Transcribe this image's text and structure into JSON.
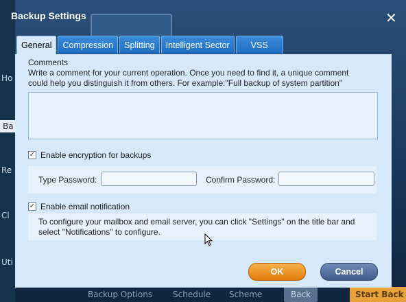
{
  "dialog": {
    "title": "Backup Settings"
  },
  "tabs": [
    {
      "label": "General",
      "active": true
    },
    {
      "label": "Compression",
      "active": false
    },
    {
      "label": "Splitting",
      "active": false
    },
    {
      "label": "Intelligent Sector",
      "active": false
    },
    {
      "label": "VSS",
      "active": false
    }
  ],
  "general": {
    "comments_heading": "Comments",
    "comments_description_line1": "Write a comment for your current operation. Once you need to find it, a unique comment",
    "comments_description_line2": "could help you distinguish it from others. For example:\"Full backup of system partition\"",
    "comment_value": "",
    "encryption_label": "Enable encryption for backups",
    "encryption_checked": true,
    "type_password_label": "Type Password:",
    "confirm_password_label": "Confirm Password:",
    "type_password_value": "",
    "confirm_password_value": "",
    "email_label": "Enable email notification",
    "email_checked": true,
    "email_info_line1": "To configure your mailbox and email server, you can click \"Settings\" on the title bar and",
    "email_info_line2": "select \"Notifications\" to configure."
  },
  "buttons": {
    "ok": "OK",
    "cancel": "Cancel"
  },
  "background": {
    "sidebar_items": [
      "Ho",
      "Ba",
      "Re",
      "Cl",
      "Uti"
    ],
    "bottom_labels": [
      "Backup Options",
      "Schedule",
      "Scheme"
    ],
    "back_label": "Back",
    "start_label": "Start Back"
  },
  "colors": {
    "panel": "#d5e9fa",
    "tab": "#1f6dc2",
    "ok": "#e47b0a",
    "cancel": "#3e5d8d"
  }
}
